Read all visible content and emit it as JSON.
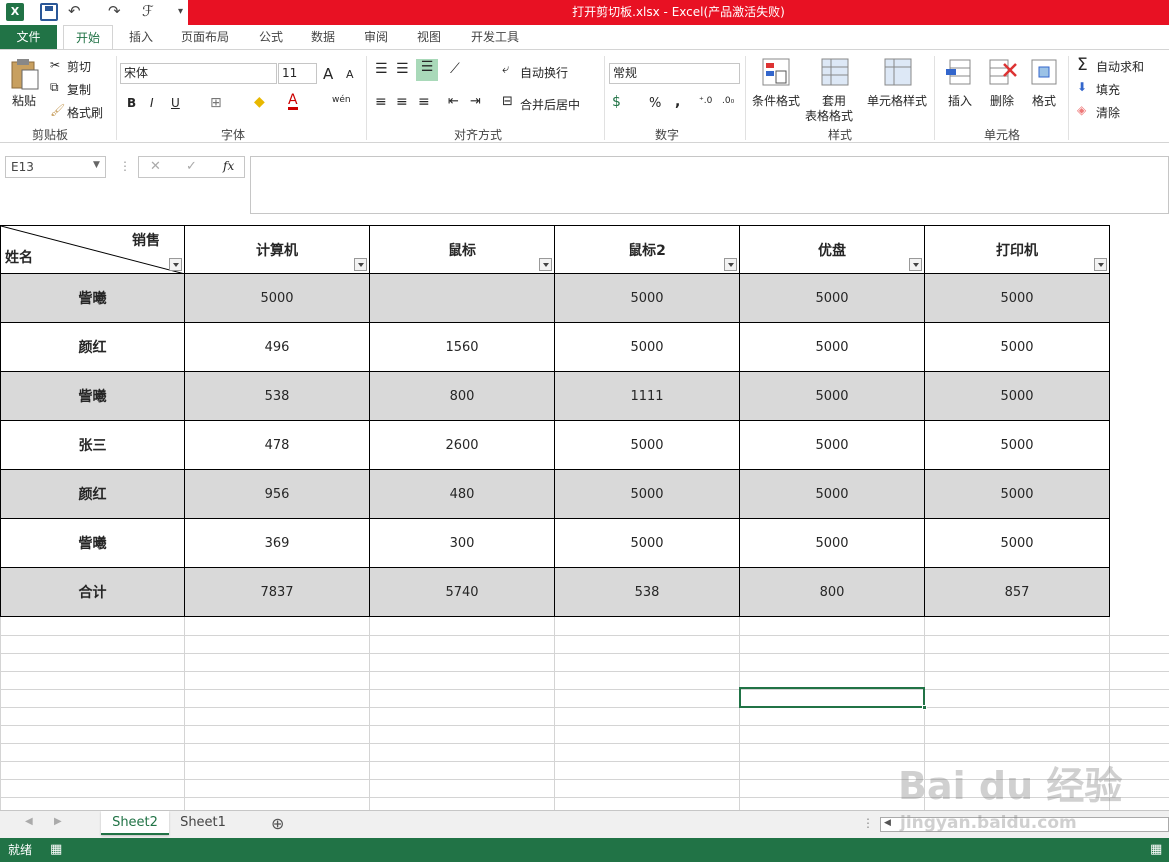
{
  "app": {
    "title": "打开剪切板.xlsx -  Excel(产品激活失败)",
    "logo": "X"
  },
  "tabs": [
    "文件",
    "开始",
    "插入",
    "页面布局",
    "公式",
    "数据",
    "审阅",
    "视图",
    "开发工具"
  ],
  "ribbon": {
    "clipboard": {
      "paste": "粘贴",
      "cut": "剪切",
      "copy": "复制",
      "format_painter": "格式刷",
      "label": "剪贴板"
    },
    "font": {
      "name": "宋体",
      "size": "11",
      "bold": "B",
      "italic": "I",
      "underline": "U",
      "label": "字体",
      "grow": "A",
      "shrink": "A",
      "font_color": "A",
      "phonetic": "wén"
    },
    "align": {
      "wrap": "自动换行",
      "merge": "合并后居中",
      "label": "对齐方式"
    },
    "number": {
      "format": "常规",
      "percent": "%",
      "comma": ",",
      "label": "数字"
    },
    "styles": {
      "cond": "条件格式",
      "table1": "套用",
      "table2": "表格格式",
      "cell": "单元格样式",
      "label": "样式"
    },
    "cells": {
      "insert": "插入",
      "delete": "删除",
      "format": "格式",
      "label": "单元格"
    },
    "editing": {
      "autosum": "自动求和",
      "fill": "填充",
      "clear": "清除"
    }
  },
  "formula_bar": {
    "name_box": "E13",
    "cancel": "✕",
    "enter": "✓",
    "fx": "fx",
    "value": ""
  },
  "table": {
    "corner_top": "销售",
    "corner_bottom": "姓名",
    "headers": [
      "计算机",
      "鼠标",
      "鼠标2",
      "优盘",
      "打印机"
    ],
    "rows": [
      {
        "name": "訾曦",
        "values": [
          "5000",
          "",
          "5000",
          "5000",
          "5000"
        ],
        "shaded": true
      },
      {
        "name": "颜红",
        "values": [
          "496",
          "1560",
          "5000",
          "5000",
          "5000"
        ],
        "shaded": false
      },
      {
        "name": "訾曦",
        "values": [
          "538",
          "800",
          "1111",
          "5000",
          "5000"
        ],
        "shaded": true
      },
      {
        "name": "张三",
        "values": [
          "478",
          "2600",
          "5000",
          "5000",
          "5000"
        ],
        "shaded": false
      },
      {
        "name": "颜红",
        "values": [
          "956",
          "480",
          "5000",
          "5000",
          "5000"
        ],
        "shaded": true
      },
      {
        "name": "訾曦",
        "values": [
          "369",
          "300",
          "5000",
          "5000",
          "5000"
        ],
        "shaded": false
      },
      {
        "name": "合计",
        "values": [
          "7837",
          "5740",
          "538",
          "800",
          "857"
        ],
        "shaded": true
      }
    ]
  },
  "sheets": [
    "Sheet2",
    "Sheet1"
  ],
  "active_sheet": "Sheet2",
  "status": {
    "ready": "就绪"
  },
  "watermark": {
    "logo": "Bai du 经验",
    "url": "jingyan.baidu.com"
  },
  "colors": {
    "accent": "#217346",
    "title_red": "#e81123",
    "shade": "#d9d9d9"
  }
}
